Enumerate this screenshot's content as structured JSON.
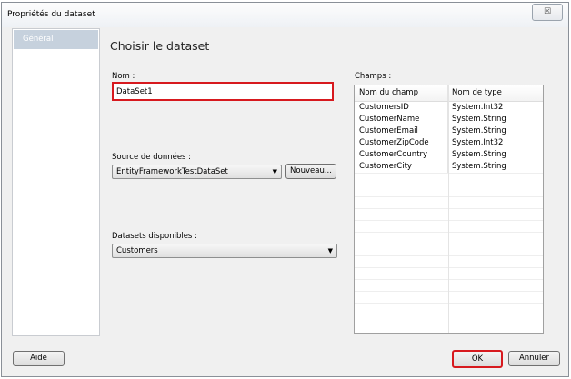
{
  "window": {
    "title": "Propriétés du dataset",
    "close": "☒"
  },
  "nav": {
    "items": [
      {
        "label": "Général"
      }
    ]
  },
  "main": {
    "heading": "Choisir le dataset",
    "name_label": "Nom :",
    "name_value": "DataSet1",
    "source_label": "Source de données :",
    "source_value": "EntityFrameworkTestDataSet",
    "new_button": "Nouveau...",
    "datasets_label": "Datasets disponibles :",
    "datasets_value": "Customers",
    "fields_label": "Champs :",
    "fields": {
      "headers": [
        "Nom du champ",
        "Nom de type"
      ],
      "rows": [
        [
          "CustomersID",
          "System.Int32"
        ],
        [
          "CustomerName",
          "System.String"
        ],
        [
          "CustomerEmail",
          "System.String"
        ],
        [
          "CustomerZipCode",
          "System.Int32"
        ],
        [
          "CustomerCountry",
          "System.String"
        ],
        [
          "CustomerCity",
          "System.String"
        ]
      ]
    }
  },
  "footer": {
    "help": "Aide",
    "ok": "OK",
    "cancel": "Annuler"
  }
}
